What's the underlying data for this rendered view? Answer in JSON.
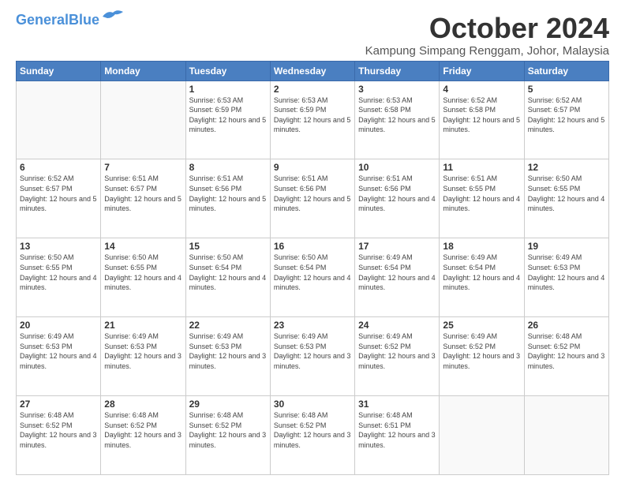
{
  "header": {
    "logo_general": "General",
    "logo_blue": "Blue",
    "month": "October 2024",
    "location": "Kampung Simpang Renggam, Johor, Malaysia"
  },
  "weekdays": [
    "Sunday",
    "Monday",
    "Tuesday",
    "Wednesday",
    "Thursday",
    "Friday",
    "Saturday"
  ],
  "weeks": [
    [
      {
        "day": "",
        "info": ""
      },
      {
        "day": "",
        "info": ""
      },
      {
        "day": "1",
        "info": "Sunrise: 6:53 AM\nSunset: 6:59 PM\nDaylight: 12 hours and 5 minutes."
      },
      {
        "day": "2",
        "info": "Sunrise: 6:53 AM\nSunset: 6:59 PM\nDaylight: 12 hours and 5 minutes."
      },
      {
        "day": "3",
        "info": "Sunrise: 6:53 AM\nSunset: 6:58 PM\nDaylight: 12 hours and 5 minutes."
      },
      {
        "day": "4",
        "info": "Sunrise: 6:52 AM\nSunset: 6:58 PM\nDaylight: 12 hours and 5 minutes."
      },
      {
        "day": "5",
        "info": "Sunrise: 6:52 AM\nSunset: 6:57 PM\nDaylight: 12 hours and 5 minutes."
      }
    ],
    [
      {
        "day": "6",
        "info": "Sunrise: 6:52 AM\nSunset: 6:57 PM\nDaylight: 12 hours and 5 minutes."
      },
      {
        "day": "7",
        "info": "Sunrise: 6:51 AM\nSunset: 6:57 PM\nDaylight: 12 hours and 5 minutes."
      },
      {
        "day": "8",
        "info": "Sunrise: 6:51 AM\nSunset: 6:56 PM\nDaylight: 12 hours and 5 minutes."
      },
      {
        "day": "9",
        "info": "Sunrise: 6:51 AM\nSunset: 6:56 PM\nDaylight: 12 hours and 5 minutes."
      },
      {
        "day": "10",
        "info": "Sunrise: 6:51 AM\nSunset: 6:56 PM\nDaylight: 12 hours and 4 minutes."
      },
      {
        "day": "11",
        "info": "Sunrise: 6:51 AM\nSunset: 6:55 PM\nDaylight: 12 hours and 4 minutes."
      },
      {
        "day": "12",
        "info": "Sunrise: 6:50 AM\nSunset: 6:55 PM\nDaylight: 12 hours and 4 minutes."
      }
    ],
    [
      {
        "day": "13",
        "info": "Sunrise: 6:50 AM\nSunset: 6:55 PM\nDaylight: 12 hours and 4 minutes."
      },
      {
        "day": "14",
        "info": "Sunrise: 6:50 AM\nSunset: 6:55 PM\nDaylight: 12 hours and 4 minutes."
      },
      {
        "day": "15",
        "info": "Sunrise: 6:50 AM\nSunset: 6:54 PM\nDaylight: 12 hours and 4 minutes."
      },
      {
        "day": "16",
        "info": "Sunrise: 6:50 AM\nSunset: 6:54 PM\nDaylight: 12 hours and 4 minutes."
      },
      {
        "day": "17",
        "info": "Sunrise: 6:49 AM\nSunset: 6:54 PM\nDaylight: 12 hours and 4 minutes."
      },
      {
        "day": "18",
        "info": "Sunrise: 6:49 AM\nSunset: 6:54 PM\nDaylight: 12 hours and 4 minutes."
      },
      {
        "day": "19",
        "info": "Sunrise: 6:49 AM\nSunset: 6:53 PM\nDaylight: 12 hours and 4 minutes."
      }
    ],
    [
      {
        "day": "20",
        "info": "Sunrise: 6:49 AM\nSunset: 6:53 PM\nDaylight: 12 hours and 4 minutes."
      },
      {
        "day": "21",
        "info": "Sunrise: 6:49 AM\nSunset: 6:53 PM\nDaylight: 12 hours and 3 minutes."
      },
      {
        "day": "22",
        "info": "Sunrise: 6:49 AM\nSunset: 6:53 PM\nDaylight: 12 hours and 3 minutes."
      },
      {
        "day": "23",
        "info": "Sunrise: 6:49 AM\nSunset: 6:53 PM\nDaylight: 12 hours and 3 minutes."
      },
      {
        "day": "24",
        "info": "Sunrise: 6:49 AM\nSunset: 6:52 PM\nDaylight: 12 hours and 3 minutes."
      },
      {
        "day": "25",
        "info": "Sunrise: 6:49 AM\nSunset: 6:52 PM\nDaylight: 12 hours and 3 minutes."
      },
      {
        "day": "26",
        "info": "Sunrise: 6:48 AM\nSunset: 6:52 PM\nDaylight: 12 hours and 3 minutes."
      }
    ],
    [
      {
        "day": "27",
        "info": "Sunrise: 6:48 AM\nSunset: 6:52 PM\nDaylight: 12 hours and 3 minutes."
      },
      {
        "day": "28",
        "info": "Sunrise: 6:48 AM\nSunset: 6:52 PM\nDaylight: 12 hours and 3 minutes."
      },
      {
        "day": "29",
        "info": "Sunrise: 6:48 AM\nSunset: 6:52 PM\nDaylight: 12 hours and 3 minutes."
      },
      {
        "day": "30",
        "info": "Sunrise: 6:48 AM\nSunset: 6:52 PM\nDaylight: 12 hours and 3 minutes."
      },
      {
        "day": "31",
        "info": "Sunrise: 6:48 AM\nSunset: 6:51 PM\nDaylight: 12 hours and 3 minutes."
      },
      {
        "day": "",
        "info": ""
      },
      {
        "day": "",
        "info": ""
      }
    ]
  ]
}
